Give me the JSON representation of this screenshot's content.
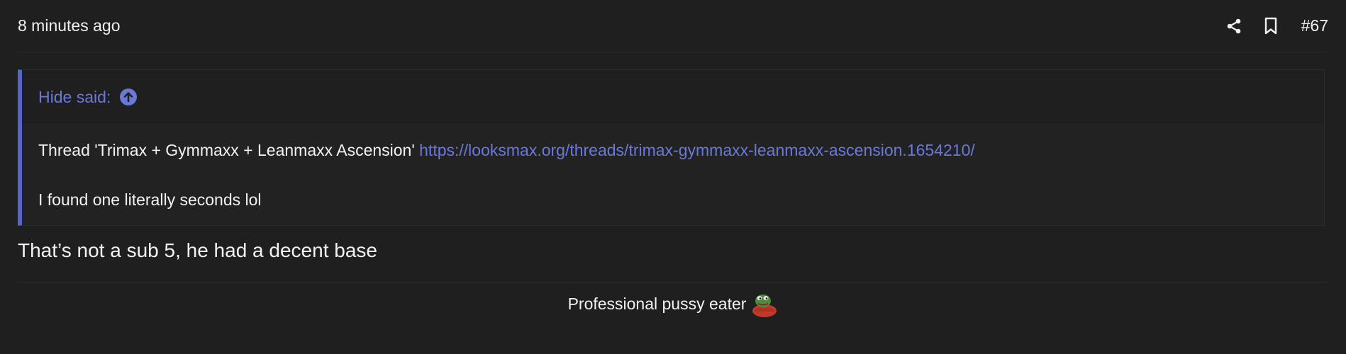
{
  "post": {
    "timestamp": "8 minutes ago",
    "number": "#67",
    "actions": {
      "share_icon": "share-icon",
      "bookmark_icon": "bookmark-icon"
    },
    "quote": {
      "author": "Hide said:",
      "jump_icon": "arrow-up-circle-icon",
      "thread_prefix": "Thread 'Trimax + Gymmaxx + Leanmaxx Ascension'",
      "link": "https://looksmax.org/threads/trimax-gymmaxx-leanmaxx-ascension.1654210/",
      "text": "I found one literally seconds lol"
    },
    "body": "That’s not a sub 5, he had a decent base",
    "signature": {
      "text": "Professional pussy eater",
      "emoji": "pepe-emoji"
    }
  },
  "colors": {
    "background": "#1f1f1f",
    "accent": "#5865c8",
    "link": "#6a79d6",
    "text": "#f2f2f2"
  }
}
